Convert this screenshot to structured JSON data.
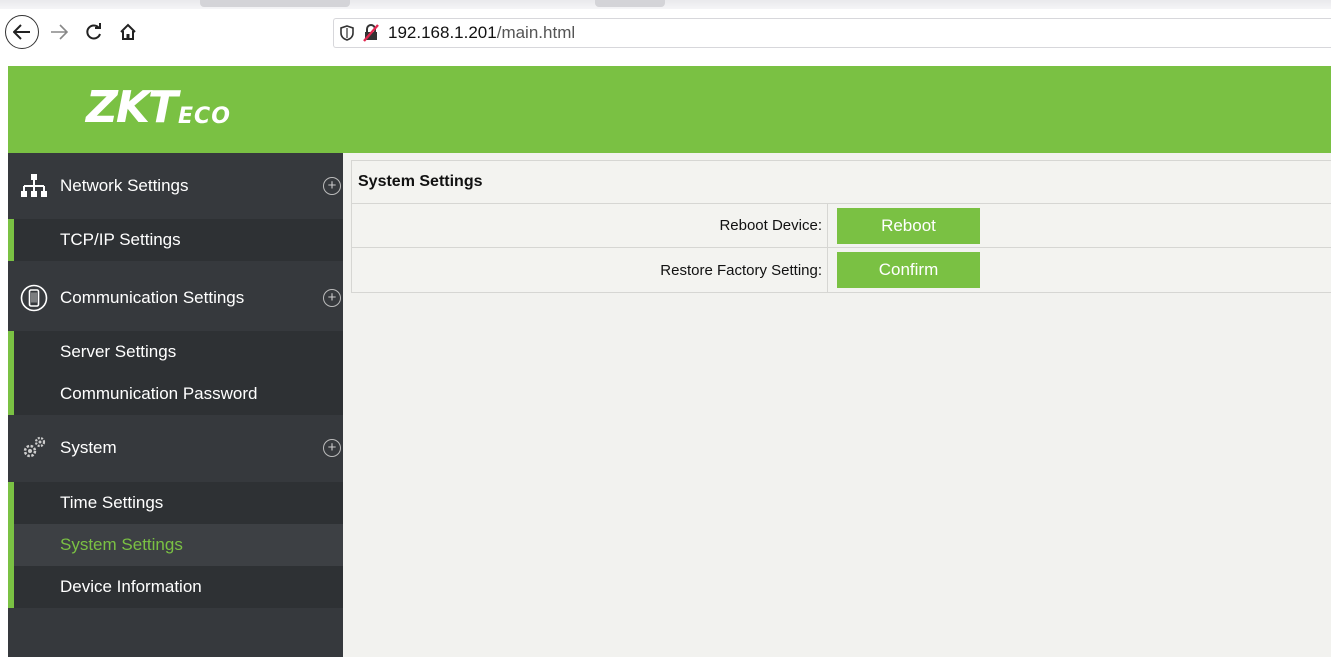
{
  "browser": {
    "back_icon": "arrow-left-icon",
    "forward_icon": "arrow-right-icon",
    "reload_icon": "reload-icon",
    "home_icon": "home-icon",
    "url_host": "192.168.1.201",
    "url_path": "/main.html"
  },
  "header": {
    "logo_main": "ZKT",
    "logo_sub": "ECO",
    "brand_color": "#7ac143"
  },
  "sidebar": {
    "groups": [
      {
        "label": "Network Settings",
        "icon": "network-icon",
        "items": [
          {
            "label": "TCP/IP Settings",
            "active": false
          }
        ]
      },
      {
        "label": "Communication Settings",
        "icon": "phone-icon",
        "items": [
          {
            "label": "Server Settings",
            "active": false
          },
          {
            "label": "Communication Password",
            "active": false
          }
        ]
      },
      {
        "label": "System",
        "icon": "gears-icon",
        "items": [
          {
            "label": "Time Settings",
            "active": false
          },
          {
            "label": "System Settings",
            "active": true
          },
          {
            "label": "Device Information",
            "active": false
          }
        ]
      }
    ]
  },
  "main": {
    "title": "System Settings",
    "rows": [
      {
        "label": "Reboot Device:",
        "button": "Reboot"
      },
      {
        "label": "Restore Factory Setting:",
        "button": "Confirm"
      }
    ]
  }
}
